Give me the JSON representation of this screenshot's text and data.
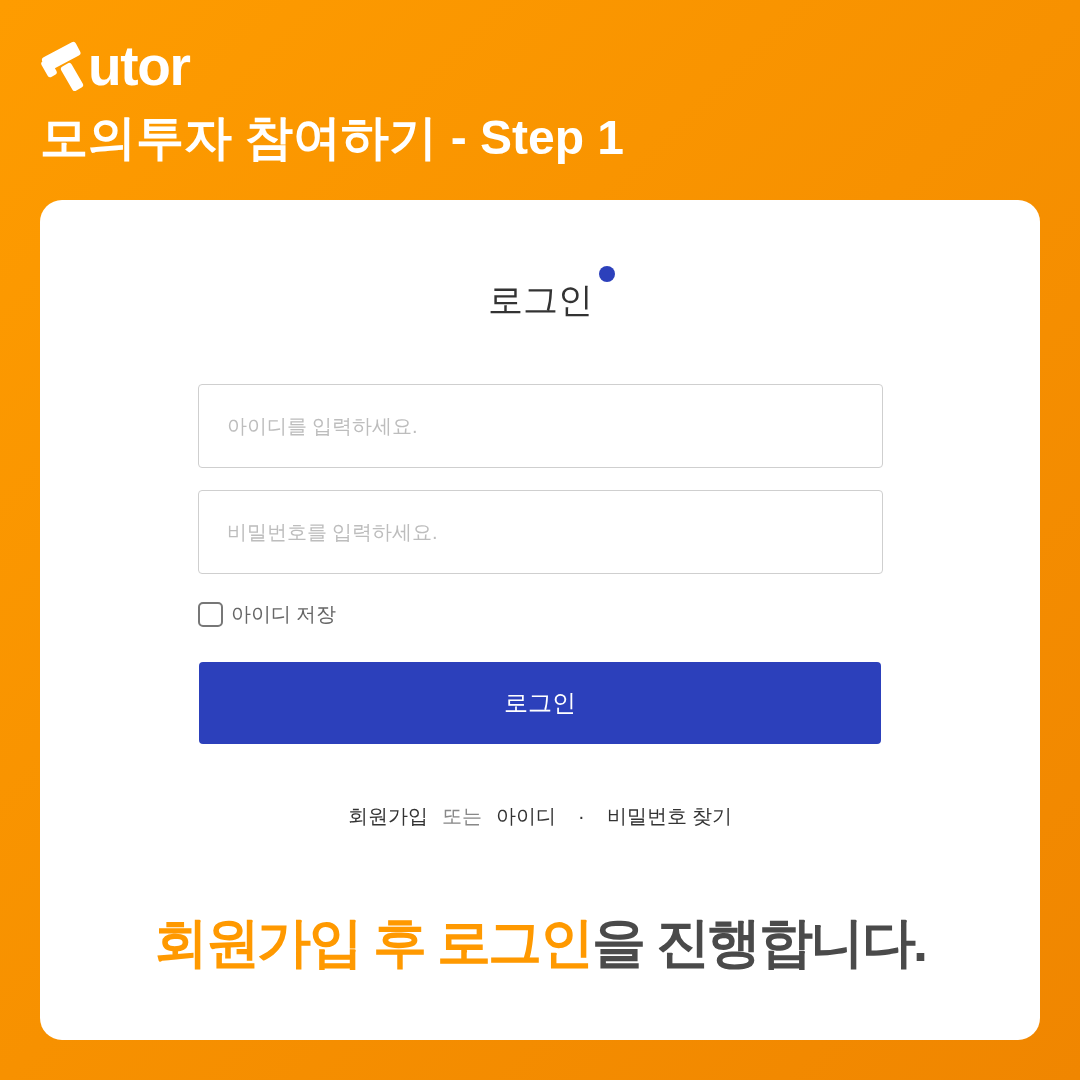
{
  "logo": {
    "text": "utor"
  },
  "page_title": "모의투자 참여하기 - Step 1",
  "login": {
    "title": "로그인",
    "id_field": {
      "placeholder": "아이디를 입력하세요."
    },
    "password_field": {
      "placeholder": "비밀번호를 입력하세요."
    },
    "remember": {
      "label": "아이디 저장",
      "checked": false
    },
    "submit": "로그인",
    "links": [
      {
        "kind": "link",
        "label": "회원가입"
      },
      {
        "kind": "text",
        "label": "또는"
      },
      {
        "kind": "link",
        "label": "아이디"
      },
      {
        "kind": "separator",
        "label": "·"
      },
      {
        "kind": "link",
        "label": "비밀번호 찾기"
      }
    ]
  },
  "caption": {
    "highlight": "회원가입 후 로그인",
    "rest": "을 진행합니다."
  }
}
